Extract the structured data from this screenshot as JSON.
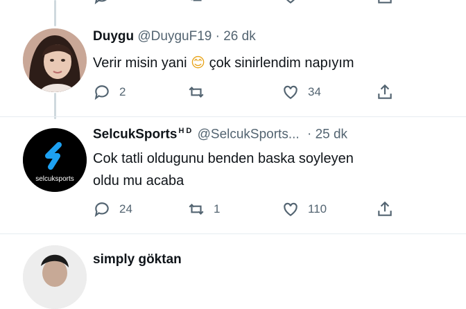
{
  "tweets": [
    {
      "display_name": "Duygu",
      "handle": "@DuyguF19",
      "separator": "·",
      "time": "26 dk",
      "text_before_emoji": "Verir misin yani ",
      "text_after_emoji": " çok sinirlendim napıyım",
      "emoji": "😊",
      "counts": {
        "reply": "2",
        "retweet": "",
        "like": "34"
      }
    },
    {
      "display_name": "SelcukSports",
      "name_suffix": "HD",
      "handle": "@SelcukSports...",
      "separator": "·",
      "time": "25 dk",
      "text_line1": "Cok tatli oldugunu benden baska soyleyen",
      "text_line2": "oldu mu acaba",
      "avatar_label": "selcuksports",
      "counts": {
        "reply": "24",
        "retweet": "1",
        "like": "110"
      }
    },
    {
      "display_name": "simply göktan"
    }
  ],
  "colors": {
    "text": "#0f1419",
    "muted": "#536471",
    "brand_blue": "#1da1f2"
  },
  "icons": [
    "reply-icon",
    "retweet-icon",
    "like-icon",
    "share-icon"
  ]
}
